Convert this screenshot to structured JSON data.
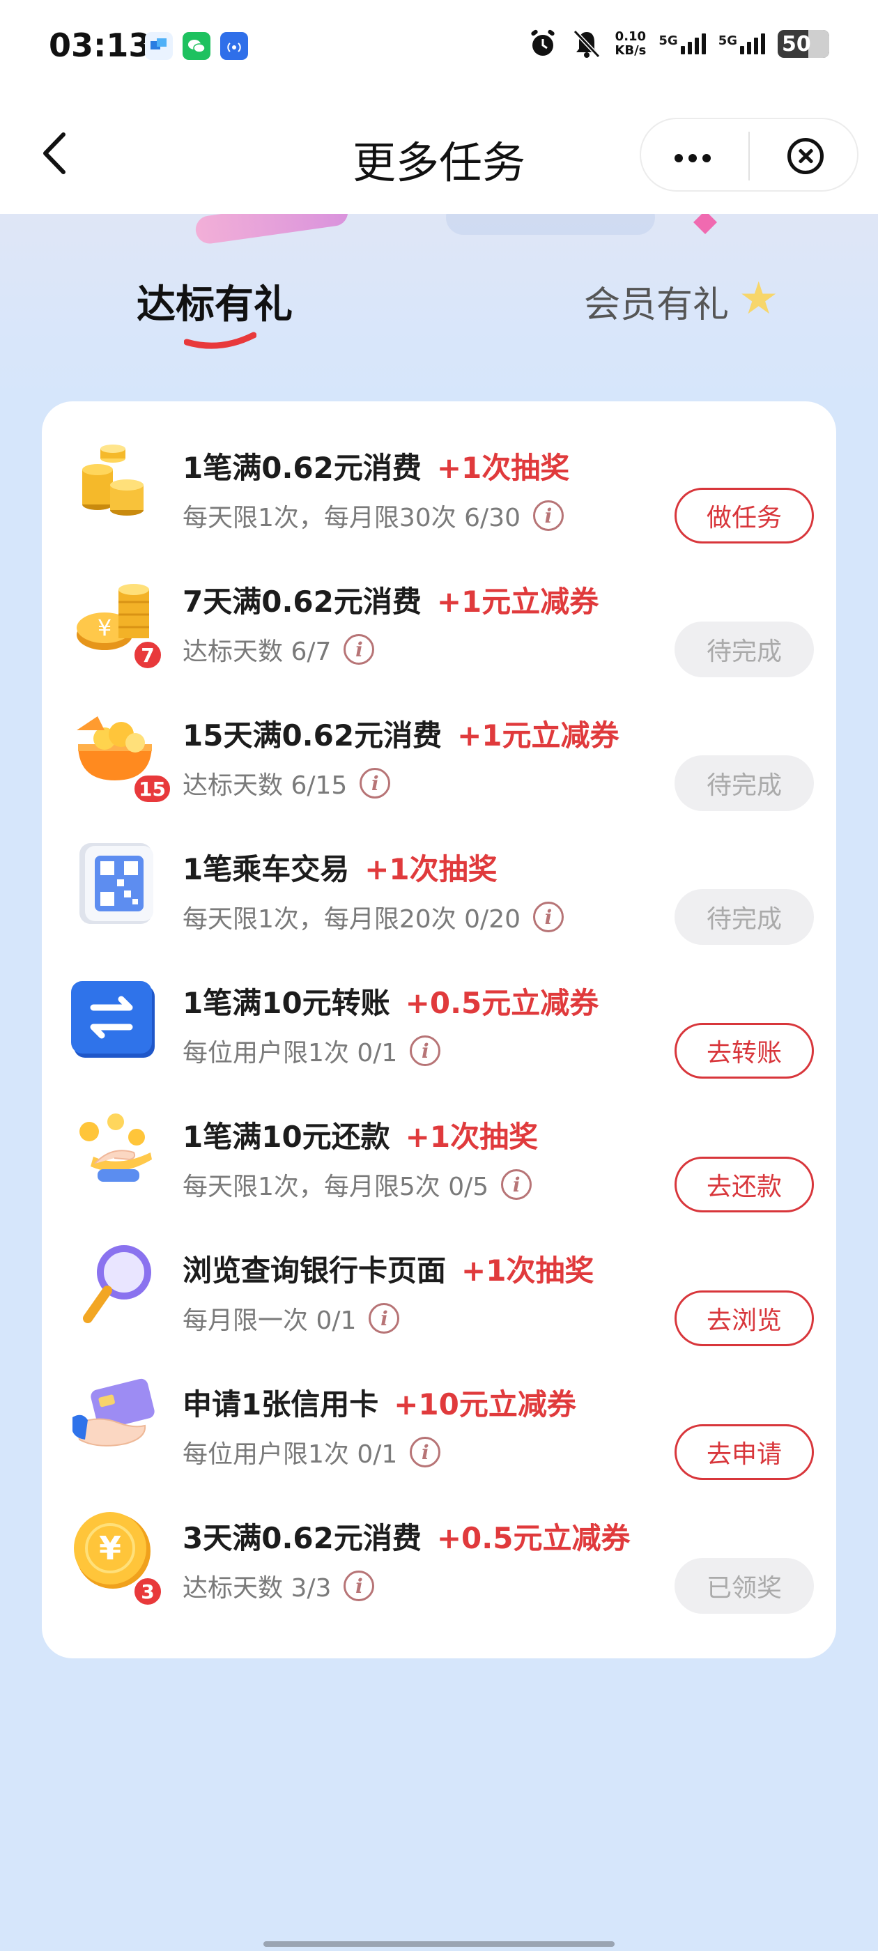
{
  "status_bar": {
    "time": "03:13",
    "net_speed": "0.10",
    "net_unit": "KB/s",
    "sim1": "5G",
    "sim2": "5G",
    "battery": "50"
  },
  "nav": {
    "title": "更多任务"
  },
  "tabs": {
    "active": "达标有礼",
    "inactive": "会员有礼"
  },
  "tasks": [
    {
      "title": "1笔满0.62元消费",
      "reward": "+1次抽奖",
      "sub": "每天限1次，每月限30次 6/30",
      "button": "做任务",
      "state": "active",
      "icon": "gold-coins-icon",
      "badge": ""
    },
    {
      "title": "7天满0.62元消费",
      "reward": "+1元立减券",
      "sub": "达标天数 6/7",
      "button": "待完成",
      "state": "disabled",
      "icon": "coin-stack-icon",
      "badge": "7"
    },
    {
      "title": "15天满0.62元消费",
      "reward": "+1元立减券",
      "sub": "达标天数 6/15",
      "button": "待完成",
      "state": "disabled",
      "icon": "treasure-chest-icon",
      "badge": "15"
    },
    {
      "title": "1笔乘车交易",
      "reward": "+1次抽奖",
      "sub": "每天限1次，每月限20次 0/20",
      "button": "待完成",
      "state": "disabled",
      "icon": "qr-code-icon",
      "badge": ""
    },
    {
      "title": "1笔满10元转账",
      "reward": "+0.5元立减券",
      "sub": "每位用户限1次 0/1",
      "button": "去转账",
      "state": "active",
      "icon": "transfer-icon",
      "badge": ""
    },
    {
      "title": "1笔满10元还款",
      "reward": "+1次抽奖",
      "sub": "每天限1次，每月限5次 0/5",
      "button": "去还款",
      "state": "active",
      "icon": "hand-coins-icon",
      "badge": ""
    },
    {
      "title": "浏览查询银行卡页面",
      "reward": "+1次抽奖",
      "sub": "每月限一次 0/1",
      "button": "去浏览",
      "state": "active",
      "icon": "magnifier-icon",
      "badge": ""
    },
    {
      "title": "申请1张信用卡",
      "reward": "+10元立减券",
      "sub": "每位用户限1次 0/1",
      "button": "去申请",
      "state": "active",
      "icon": "credit-card-icon",
      "badge": ""
    },
    {
      "title": "3天满0.62元消费",
      "reward": "+0.5元立减券",
      "sub": "达标天数 3/3",
      "button": "已领奖",
      "state": "disabled",
      "icon": "yuan-coin-icon",
      "badge": "3"
    }
  ]
}
